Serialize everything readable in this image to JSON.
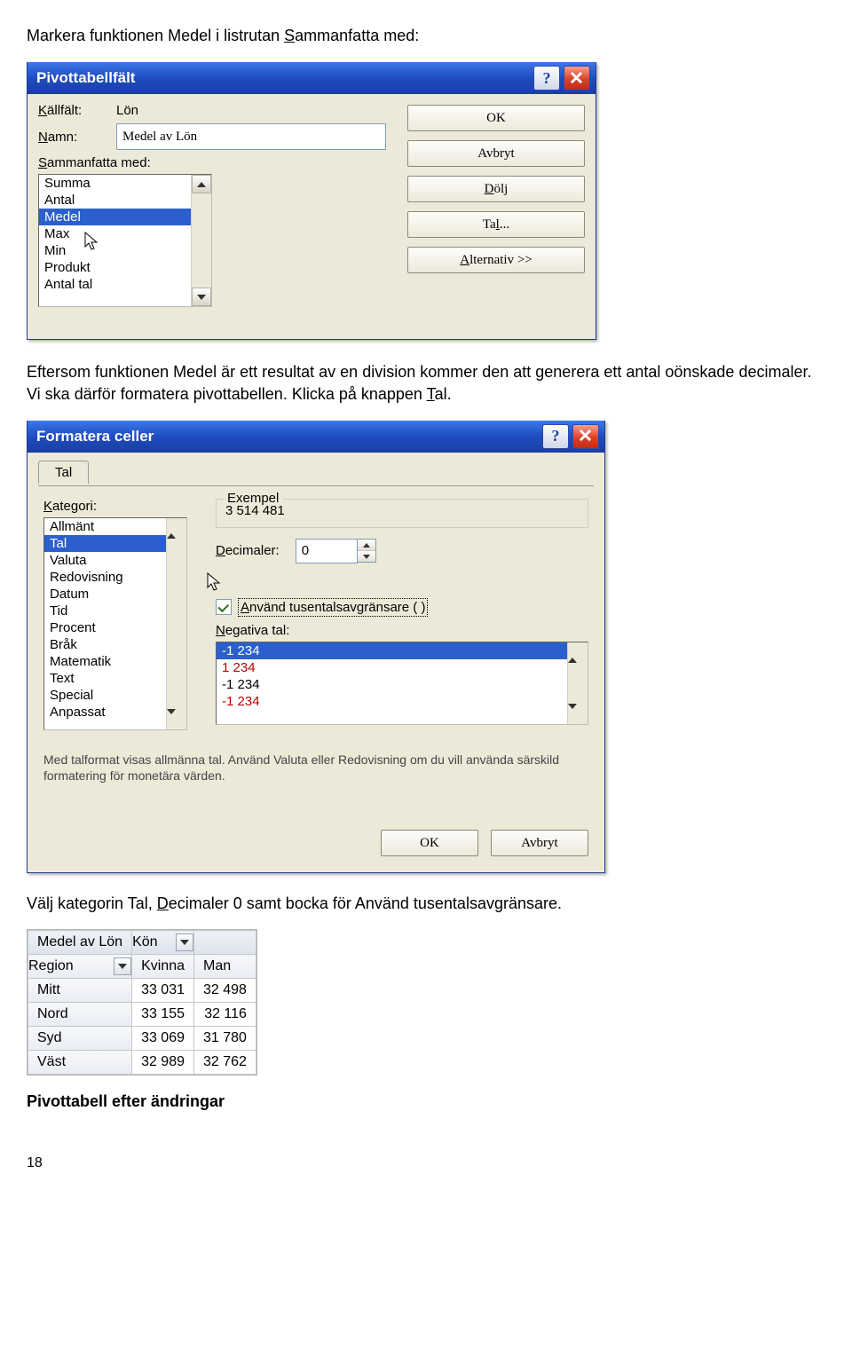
{
  "intro": {
    "p1_a": "Markera funktionen Medel i listrutan ",
    "p1_hot": "S",
    "p1_b": "ammanfatta med:"
  },
  "dlg1": {
    "title": "Pivottabellfält",
    "kallfalt_label": "Källfält:",
    "kallfalt_value": "Lön",
    "namn_label": "Namn:",
    "namn_value": "Medel av Lön",
    "sammanfatta_label": "Sammanfatta med:",
    "items": [
      "Summa",
      "Antal",
      "Medel",
      "Max",
      "Min",
      "Produkt",
      "Antal tal"
    ],
    "buttons": {
      "ok": "OK",
      "avbryt": "Avbryt",
      "dolj": "Dölj",
      "tal": "Tal...",
      "alternativ": "Alternativ >>"
    }
  },
  "para2": {
    "a": "Eftersom funktionen Medel är ett resultat av en division kommer den att generera ett antal oönskade decimaler. Vi ska därför formatera pivottabellen. Klicka på knappen ",
    "hot": "T",
    "b": "al."
  },
  "dlg2": {
    "title": "Formatera celler",
    "tab": "Tal",
    "kategori_label": "Kategori:",
    "categories": [
      "Allmänt",
      "Tal",
      "Valuta",
      "Redovisning",
      "Datum",
      "Tid",
      "Procent",
      "Bråk",
      "Matematik",
      "Text",
      "Special",
      "Anpassat"
    ],
    "exempel_label": "Exempel",
    "exempel_value": "3 514 481",
    "decimaler_label": "Decimaler:",
    "decimaler_value": "0",
    "chk_label": "Använd tusentalsavgränsare ( )",
    "neg_label": "Negativa tal:",
    "neg_items": [
      "-1 234",
      "1 234",
      "-1 234",
      "-1 234"
    ],
    "desc": "Med talformat visas allmänna tal. Använd Valuta eller Redovisning om du vill använda särskild formatering för monetära värden.",
    "buttons": {
      "ok": "OK",
      "avbryt": "Avbryt"
    }
  },
  "para3": {
    "a": "Välj kategorin Tal, ",
    "hot": "D",
    "b": "ecimaler 0 samt bocka för Använd tusentalsavgränsare."
  },
  "result": {
    "corner": "Medel av Lön",
    "coldrop": "Kön",
    "rowdrop": "Region",
    "cols": [
      "Kvinna",
      "Man"
    ],
    "rows": [
      {
        "region": "Mitt",
        "Kvinna": "33 031",
        "Man": "32 498"
      },
      {
        "region": "Nord",
        "Kvinna": "33 155",
        "Man": "32 116"
      },
      {
        "region": "Syd",
        "Kvinna": "33 069",
        "Man": "31 780"
      },
      {
        "region": "Väst",
        "Kvinna": "32 989",
        "Man": "32 762"
      }
    ],
    "caption": "Pivottabell efter ändringar"
  },
  "pagenum": "18",
  "chart_data": {
    "type": "table",
    "title": "Medel av Lön",
    "row_field": "Region",
    "col_field": "Kön",
    "columns": [
      "Kvinna",
      "Man"
    ],
    "rows": [
      "Mitt",
      "Nord",
      "Syd",
      "Väst"
    ],
    "values": [
      [
        33031,
        32498
      ],
      [
        33155,
        32116
      ],
      [
        33069,
        31780
      ],
      [
        32989,
        32762
      ]
    ]
  }
}
